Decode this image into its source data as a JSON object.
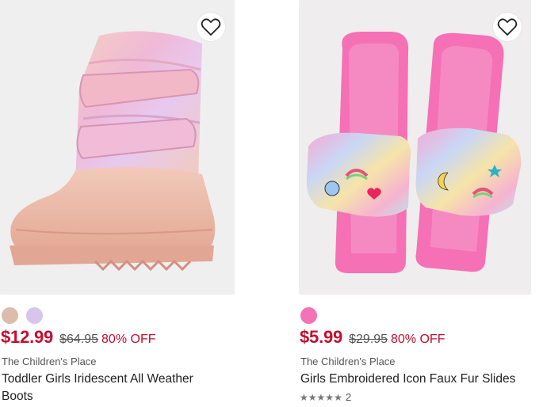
{
  "products": [
    {
      "image_alt": "Toddler Girls Iridescent All Weather Boots",
      "swatches": [
        {
          "color": "#dcbcaa"
        },
        {
          "color": "#d8c5ee"
        }
      ],
      "price": {
        "sale": "$12.99",
        "original": "$64.95",
        "discount": "80% OFF"
      },
      "brand": "The Children's Place",
      "title": "Toddler Girls Iridescent All Weather Boots"
    },
    {
      "image_alt": "Girls Embroidered Icon Faux Fur Slides",
      "swatches": [
        {
          "color": "#f472b6"
        }
      ],
      "price": {
        "sale": "$5.99",
        "original": "$29.95",
        "discount": "80% OFF"
      },
      "brand": "The Children's Place",
      "title": "Girls Embroidered Icon Faux Fur Slides",
      "rating": {
        "stars": 5,
        "count": "2"
      }
    }
  ],
  "colors": {
    "sale_red": "#c40f2f",
    "text": "#222222",
    "muted": "#555555",
    "image_bg": "#f0eff0"
  },
  "icons": {
    "wishlist": "heart-outline-icon",
    "rating": "star-icon"
  }
}
